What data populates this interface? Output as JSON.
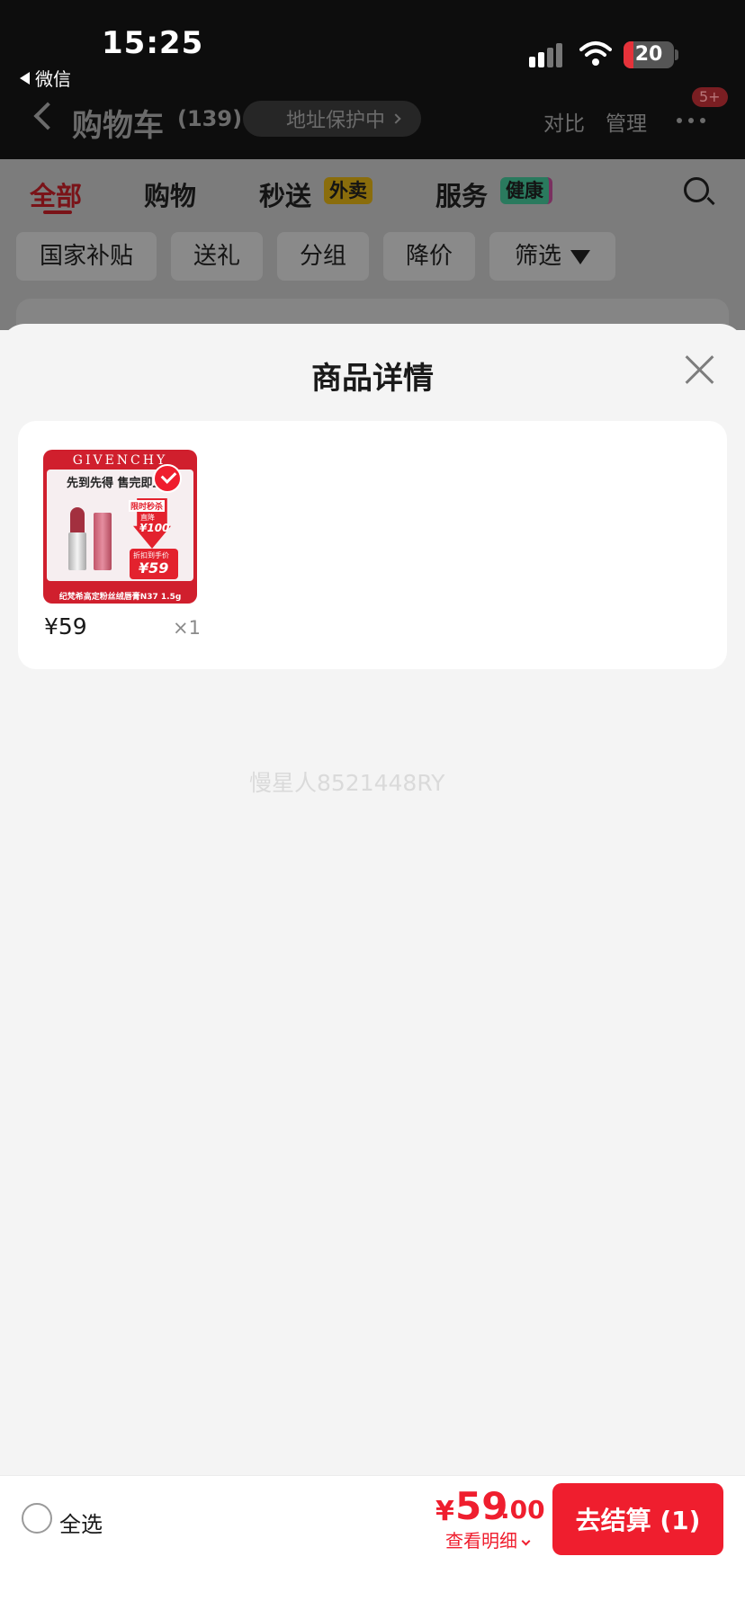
{
  "status_bar": {
    "time": "15:25",
    "back_app": "微信",
    "battery": "20",
    "battery_level": 0.2
  },
  "nav": {
    "title": "购物车",
    "count": "(139)",
    "address_status": "地址保护中",
    "compare": "对比",
    "manage": "管理",
    "more_badge": "5+"
  },
  "tabs": [
    {
      "label": "全部",
      "active": true
    },
    {
      "label": "购物",
      "active": false
    },
    {
      "label": "秒送",
      "tag": "外卖"
    },
    {
      "label": "服务",
      "tag": "健康"
    }
  ],
  "filters": [
    "国家补贴",
    "送礼",
    "分组",
    "降价",
    "筛选"
  ],
  "sheet": {
    "title": "商品详情",
    "product": {
      "image_brand": "GIVENCHY",
      "image_slogan": "先到先得 售完即止",
      "image_flash": "限时秒杀",
      "image_flash_sub": "直降",
      "image_flash_amount": "¥100",
      "image_price_label": "折扣到手价",
      "image_price": "¥59",
      "image_caption": "纪梵希高定粉丝绒唇膏N37 1.5g",
      "price": "¥59",
      "quantity": "×1",
      "selected": true
    },
    "watermark": "慢星人8521448RY"
  },
  "bottom": {
    "select_all": "全选",
    "currency": "¥",
    "total_int": "59",
    "total_dec": ".00",
    "detail": "查看明细",
    "checkout": "去结算 (1)"
  },
  "colors": {
    "accent": "#ef1e2e",
    "header_bg": "#0d0d0d",
    "sheet_bg": "#f4f4f4"
  }
}
